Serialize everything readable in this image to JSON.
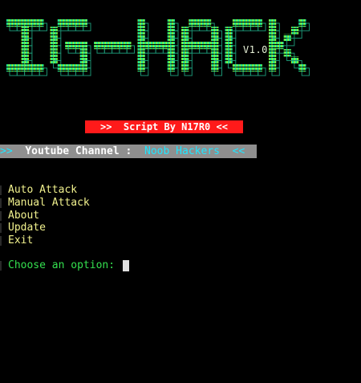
{
  "banner": {
    "title": "IG-HACK",
    "version": "V1.0"
  },
  "credit": ">>  Script By N17R0 <<",
  "channel": {
    "open": ">>  ",
    "label": "Youtube Channel :  ",
    "name": "Noob Hackers",
    "close": "  <<"
  },
  "menu": {
    "items": [
      "Auto Attack",
      "Manual Attack",
      "About",
      "Update",
      "Exit"
    ]
  },
  "prompt": "Choose an option: ",
  "colors": {
    "background": "#000000",
    "title_gradient_start": "#1de9b6",
    "title_gradient_end": "#a6f01a",
    "credit_bg": "#ff1a1a",
    "channel_bg": "#8f8f8f",
    "channel_name": "#20e6ff",
    "menu_text": "#f2f28e",
    "prompt_text": "#34e04f"
  }
}
